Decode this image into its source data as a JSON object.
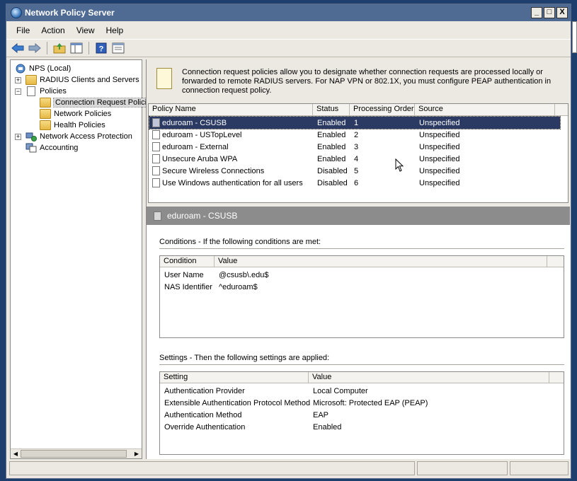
{
  "window": {
    "title": "Network Policy Server"
  },
  "title_buttons": [
    "_",
    "□",
    "X"
  ],
  "menu": [
    "File",
    "Action",
    "View",
    "Help"
  ],
  "toolbar": {
    "icons": [
      "back-arrow-icon",
      "forward-arrow-icon",
      "up-folder-icon",
      "show-hide-tree-icon",
      "help-icon",
      "properties-icon"
    ],
    "help_glyph": "?"
  },
  "tree": {
    "root": "NPS (Local)",
    "radius_clients": "RADIUS Clients and Servers",
    "policies": "Policies",
    "connection_request": "Connection Request Polici",
    "network_policies": "Network Policies",
    "health_policies": "Health Policies",
    "nap": "Network Access Protection",
    "accounting": "Accounting",
    "expander_plus": "+",
    "expander_minus": "−"
  },
  "description": "Connection request policies allow you to designate whether connection requests are processed locally or forwarded to remote RADIUS servers. For NAP VPN or 802.1X, you must configure PEAP authentication in connection request policy.",
  "policy_list": {
    "columns": [
      "Policy Name",
      "Status",
      "Processing Order",
      "Source"
    ],
    "rows": [
      {
        "name": "eduroam - CSUSB",
        "status": "Enabled",
        "order": "1",
        "source": "Unspecified",
        "selected": true
      },
      {
        "name": "eduroam - USTopLevel",
        "status": "Enabled",
        "order": "2",
        "source": "Unspecified"
      },
      {
        "name": "eduroam - External",
        "status": "Enabled",
        "order": "3",
        "source": "Unspecified"
      },
      {
        "name": "Unsecure Aruba WPA",
        "status": "Enabled",
        "order": "4",
        "source": "Unspecified"
      },
      {
        "name": "Secure Wireless Connections",
        "status": "Disabled",
        "order": "5",
        "source": "Unspecified"
      },
      {
        "name": "Use Windows authentication for all users",
        "status": "Disabled",
        "order": "6",
        "source": "Unspecified"
      }
    ]
  },
  "detail": {
    "title": "eduroam - CSUSB",
    "conditions_title": "Conditions - If the following conditions are met:",
    "conditions_columns": [
      "Condition",
      "Value"
    ],
    "conditions": [
      {
        "condition": "User Name",
        "value": "@csusb\\.edu$"
      },
      {
        "condition": "NAS Identifier",
        "value": "^eduroam$"
      }
    ],
    "settings_title": "Settings - Then the following settings are applied:",
    "settings_columns": [
      "Setting",
      "Value"
    ],
    "settings": [
      {
        "setting": "Authentication Provider",
        "value": "Local Computer"
      },
      {
        "setting": "Extensible Authentication Protocol Method",
        "value": "Microsoft: Protected EAP (PEAP)"
      },
      {
        "setting": "Authentication Method",
        "value": "EAP"
      },
      {
        "setting": "Override Authentication",
        "value": "Enabled"
      }
    ]
  },
  "colors": {
    "titlebar": "#4f6b93",
    "selection": "#2a3a63",
    "detail_band": "#8c8c8c"
  }
}
